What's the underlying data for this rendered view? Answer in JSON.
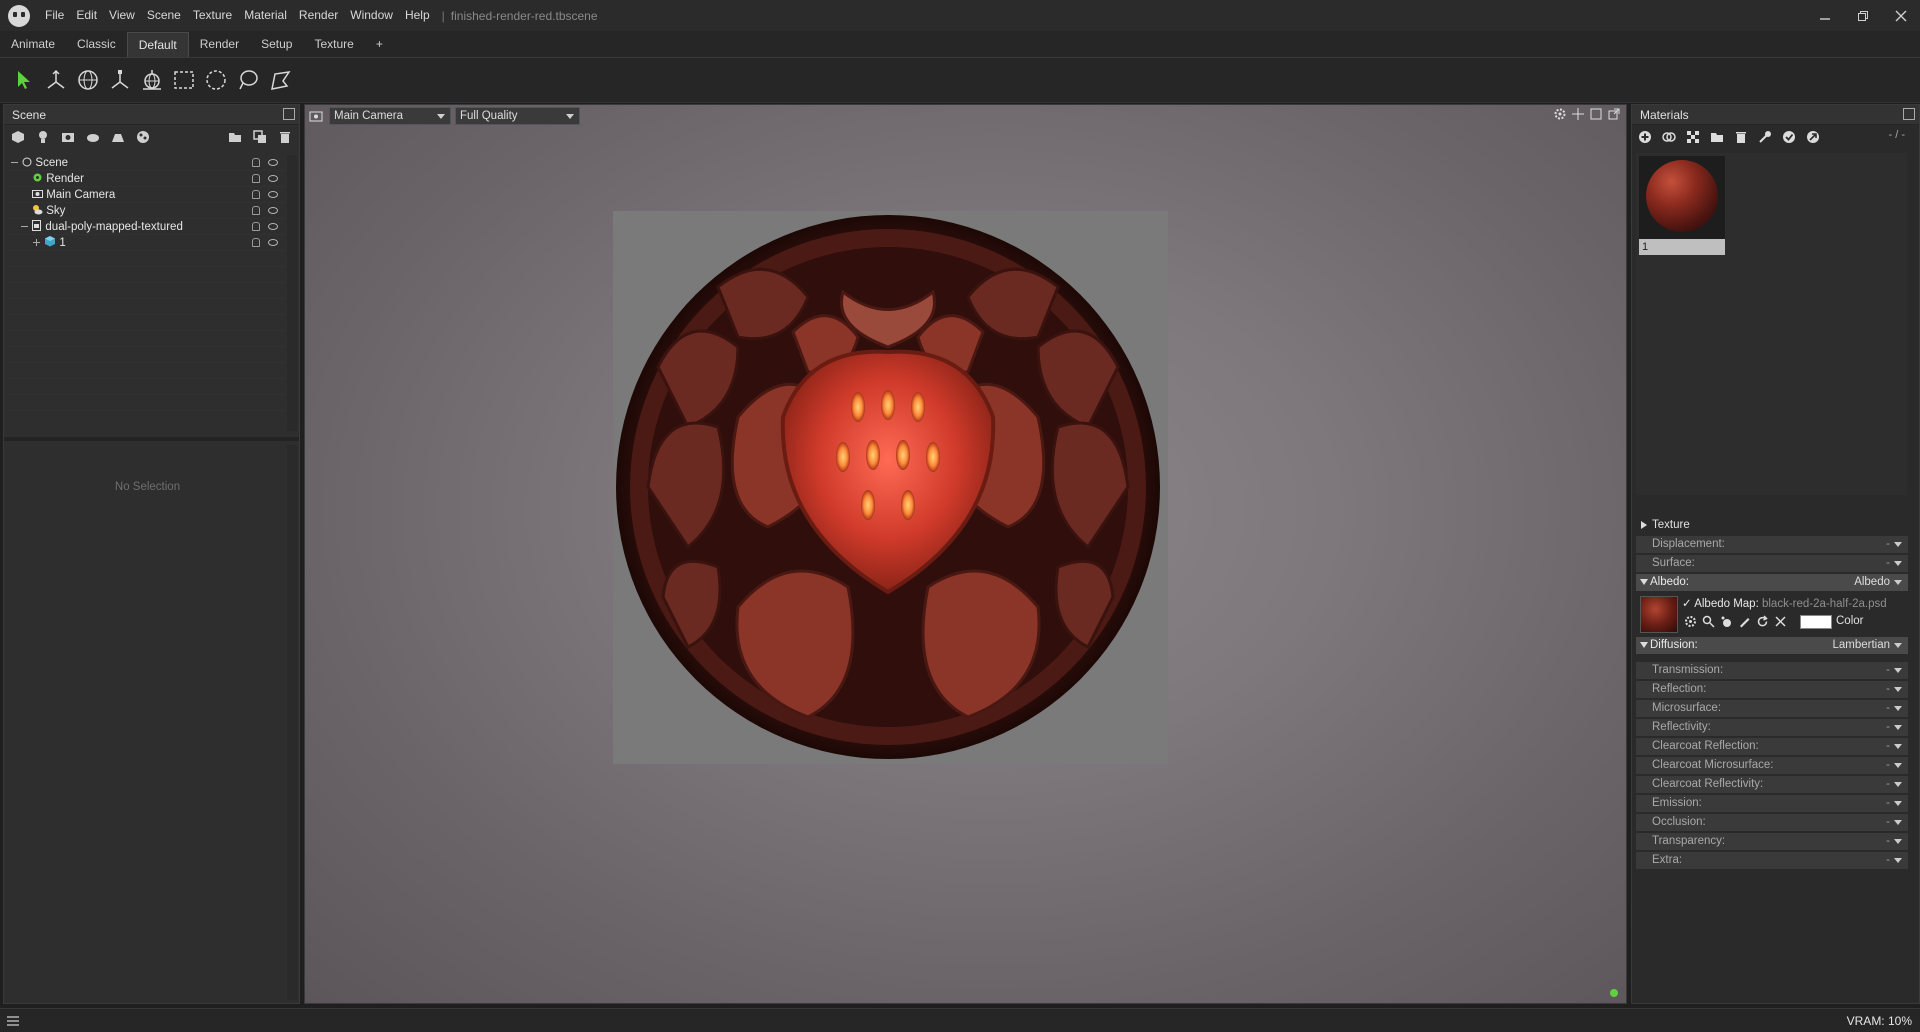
{
  "titlebar": {
    "menu": [
      "File",
      "Edit",
      "View",
      "Scene",
      "Texture",
      "Material",
      "Render",
      "Window",
      "Help"
    ],
    "doc_title": "finished-render-red.tbscene"
  },
  "workspace_tabs": [
    "Animate",
    "Classic",
    "Default",
    "Render",
    "Setup",
    "Texture",
    "+"
  ],
  "active_tab": "Default",
  "scene_panel": {
    "title": "Scene",
    "tree": [
      {
        "label": "Scene",
        "icon": "scene-icon"
      },
      {
        "label": "Render",
        "icon": "render-gear-icon"
      },
      {
        "label": "Main Camera",
        "icon": "camera-icon"
      },
      {
        "label": "Sky",
        "icon": "sky-icon"
      },
      {
        "label": "dual-poly-mapped-textured",
        "icon": "mesh-file-icon"
      },
      {
        "label": "1",
        "icon": "cube-icon"
      }
    ],
    "no_selection": "No Selection"
  },
  "viewport": {
    "camera_select": "Main Camera",
    "quality_select": "Full Quality"
  },
  "materials_panel": {
    "title": "Materials",
    "counter": "- / -",
    "thumb_label": "1",
    "sections": {
      "texture": "Texture",
      "displacement": "Displacement:",
      "surface": "Surface:",
      "albedo": "Albedo:",
      "albedo_value": "Albedo",
      "albedo_map_label": "Albedo Map:",
      "albedo_map_file": "black-red-2a-half-2a.psd",
      "color_label": "Color",
      "diffusion": "Diffusion:",
      "diffusion_value": "Lambertian",
      "rows": [
        "Transmission:",
        "Reflection:",
        "Microsurface:",
        "Reflectivity:",
        "Clearcoat Reflection:",
        "Clearcoat Microsurface:",
        "Clearcoat Reflectivity:",
        "Emission:",
        "Occlusion:",
        "Transparency:",
        "Extra:"
      ],
      "dash": "-"
    }
  },
  "statusbar": {
    "vram": "VRAM: 10%"
  },
  "colors": {
    "accent_green": "#5fd13f",
    "albedo_swatch": "#ffffff"
  }
}
